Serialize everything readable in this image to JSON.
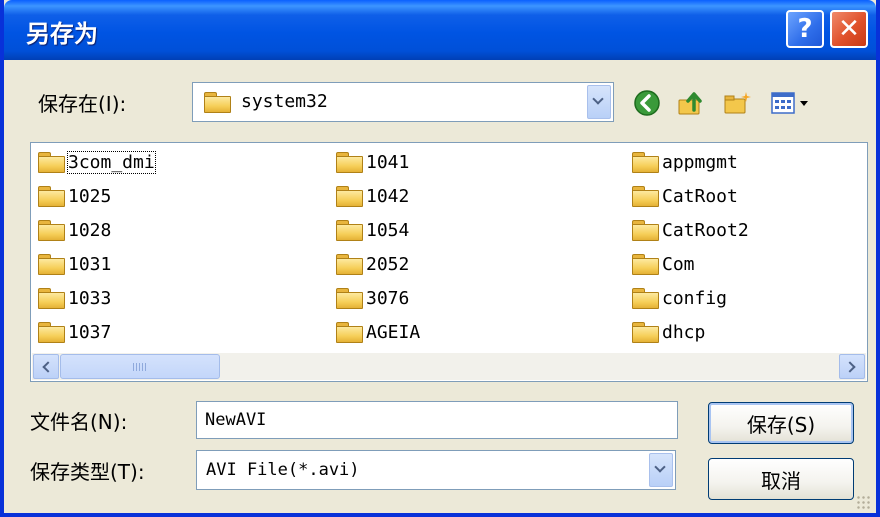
{
  "dialog": {
    "title": "另存为",
    "help_label": "?",
    "close_label": "✕"
  },
  "save_in": {
    "label": "保存在(I):",
    "current_folder": "system32"
  },
  "toolbar": {
    "icons": [
      "back-icon",
      "up-folder-icon",
      "new-folder-icon",
      "view-menu-icon"
    ],
    "colors": {
      "back": "#2e8b2e",
      "folder": "#f6cf59"
    }
  },
  "files": {
    "column1": [
      "3com_dmi",
      "1025",
      "1028",
      "1031",
      "1033",
      "1037"
    ],
    "column2": [
      "1041",
      "1042",
      "1054",
      "2052",
      "3076",
      "AGEIA"
    ],
    "column3": [
      "appmgmt",
      "CatRoot",
      "CatRoot2",
      "Com",
      "config",
      "dhcp"
    ]
  },
  "filename": {
    "label": "文件名(N):",
    "value": "NewAVI"
  },
  "filetype": {
    "label": "保存类型(T):",
    "value": "AVI File(*.avi)"
  },
  "buttons": {
    "save": "保存(S)",
    "cancel": "取消"
  }
}
